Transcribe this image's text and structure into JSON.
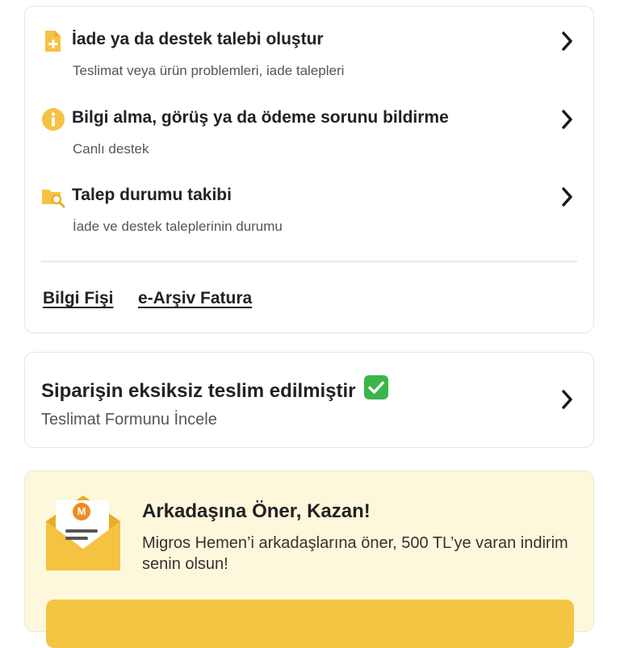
{
  "support": {
    "items": [
      {
        "title": "İade ya da destek talebi oluştur",
        "subtitle": "Teslimat veya ürün problemleri, iade talepleri",
        "icon": "document-plus-icon"
      },
      {
        "title": "Bilgi alma, görüş ya da ödeme sorunu bildirme",
        "subtitle": "Canlı destek",
        "icon": "info-icon"
      },
      {
        "title": "Talep durumu takibi",
        "subtitle": "İade ve destek taleplerinin durumu",
        "icon": "folder-search-icon"
      }
    ],
    "links": {
      "receipt": "Bilgi Fişi",
      "invoice": "e-Arşiv Fatura"
    }
  },
  "delivery": {
    "title": "Siparişin eksiksiz teslim edilmiştir",
    "subtitle": "Teslimat Formunu İncele"
  },
  "referral": {
    "title": "Arkadaşına Öner, Kazan!",
    "text": "Migros Hemen’i arkadaşlarına öner, 500 TL’ye varan indirim senin olsun!",
    "envelope_badge": "M",
    "button_label": ""
  },
  "colors": {
    "accent": "#f4c542",
    "icon_yellow": "#f5c242",
    "check_green": "#3bb54a",
    "promo_bg": "#fdf7dc"
  }
}
